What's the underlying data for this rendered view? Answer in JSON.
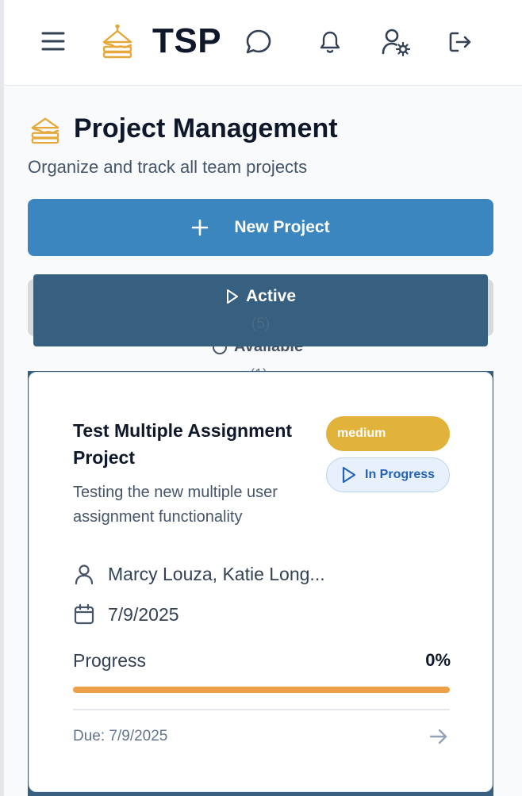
{
  "header": {
    "logo_text": "TSP",
    "icons": [
      "menu-icon",
      "sandwich-logo-icon",
      "chat-icon",
      "bell-icon",
      "user-settings-icon",
      "logout-icon"
    ]
  },
  "page": {
    "title": "Project Management",
    "subtitle": "Organize and track all team projects",
    "new_project_label": "New Project"
  },
  "tabs": {
    "active": {
      "label": "Active",
      "count": "(5)"
    },
    "available": {
      "label": "Available",
      "count": "(1)"
    }
  },
  "project": {
    "title": "Test Multiple Assignment Project",
    "description": "Testing the new multiple user assignment functionality",
    "priority": "medium",
    "status": "In Progress",
    "assignees": "Marcy Louza, Katie Long...",
    "date": "7/9/2025",
    "progress_label": "Progress",
    "progress_value": "0%",
    "progress_fraction": 0,
    "due": "Due: 7/9/2025"
  },
  "colors": {
    "primary": "#3b86bf",
    "active_tab": "#365f80",
    "priority_medium": "#e1b33b",
    "progress_track": "#eda04a",
    "status_blue": "#2563b8"
  }
}
